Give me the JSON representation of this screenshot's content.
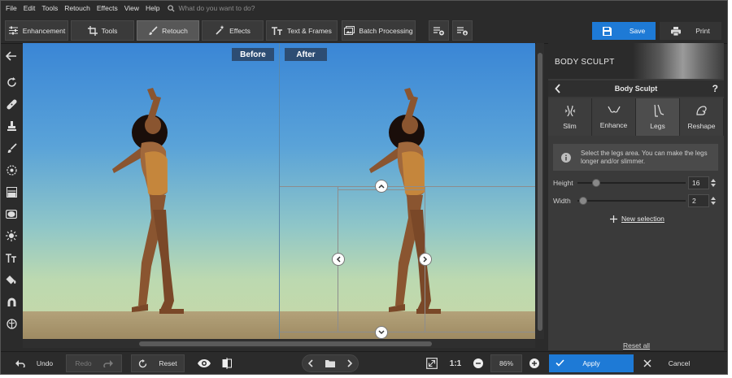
{
  "menu": {
    "items": [
      "File",
      "Edit",
      "Tools",
      "Retouch",
      "Effects",
      "View",
      "Help"
    ],
    "search_placeholder": "What do you want to do?"
  },
  "toolbar": {
    "tabs": [
      {
        "label": "Enhancement",
        "icon": "sliders-icon"
      },
      {
        "label": "Tools",
        "icon": "crop-icon"
      },
      {
        "label": "Retouch",
        "icon": "brush-icon",
        "active": true
      },
      {
        "label": "Effects",
        "icon": "magic-wand-icon"
      },
      {
        "label": "Text & Frames",
        "icon": "text-icon"
      }
    ],
    "batch_label": "Batch Processing",
    "save_label": "Save",
    "print_label": "Print"
  },
  "canvas": {
    "before_label": "Before",
    "after_label": "After"
  },
  "panel": {
    "header_title": "BODY SCULPT",
    "subheader_title": "Body Sculpt",
    "help": "?",
    "modes": [
      {
        "label": "Slim",
        "icon": "body-slim-icon"
      },
      {
        "label": "Enhance",
        "icon": "bust-icon"
      },
      {
        "label": "Legs",
        "icon": "legs-icon",
        "active": true
      },
      {
        "label": "Reshape",
        "icon": "reshape-icon"
      }
    ],
    "info_text": "Select the legs area. You can make the legs longer and/or slimmer.",
    "height_label": "Height",
    "height_value": "16",
    "width_label": "Width",
    "width_value": "2",
    "new_selection_label": "New selection",
    "reset_all_label": "Reset all"
  },
  "bottombar": {
    "undo_label": "Undo",
    "redo_label": "Redo",
    "reset_label": "Reset",
    "one_to_one": "1:1",
    "zoom_value": "86%",
    "apply_label": "Apply",
    "cancel_label": "Cancel"
  },
  "colors": {
    "accent": "#1e7ad6",
    "chip": "#2d4d73",
    "panel_bg": "#3a3a3a",
    "app_bg": "#2b2b2b"
  }
}
